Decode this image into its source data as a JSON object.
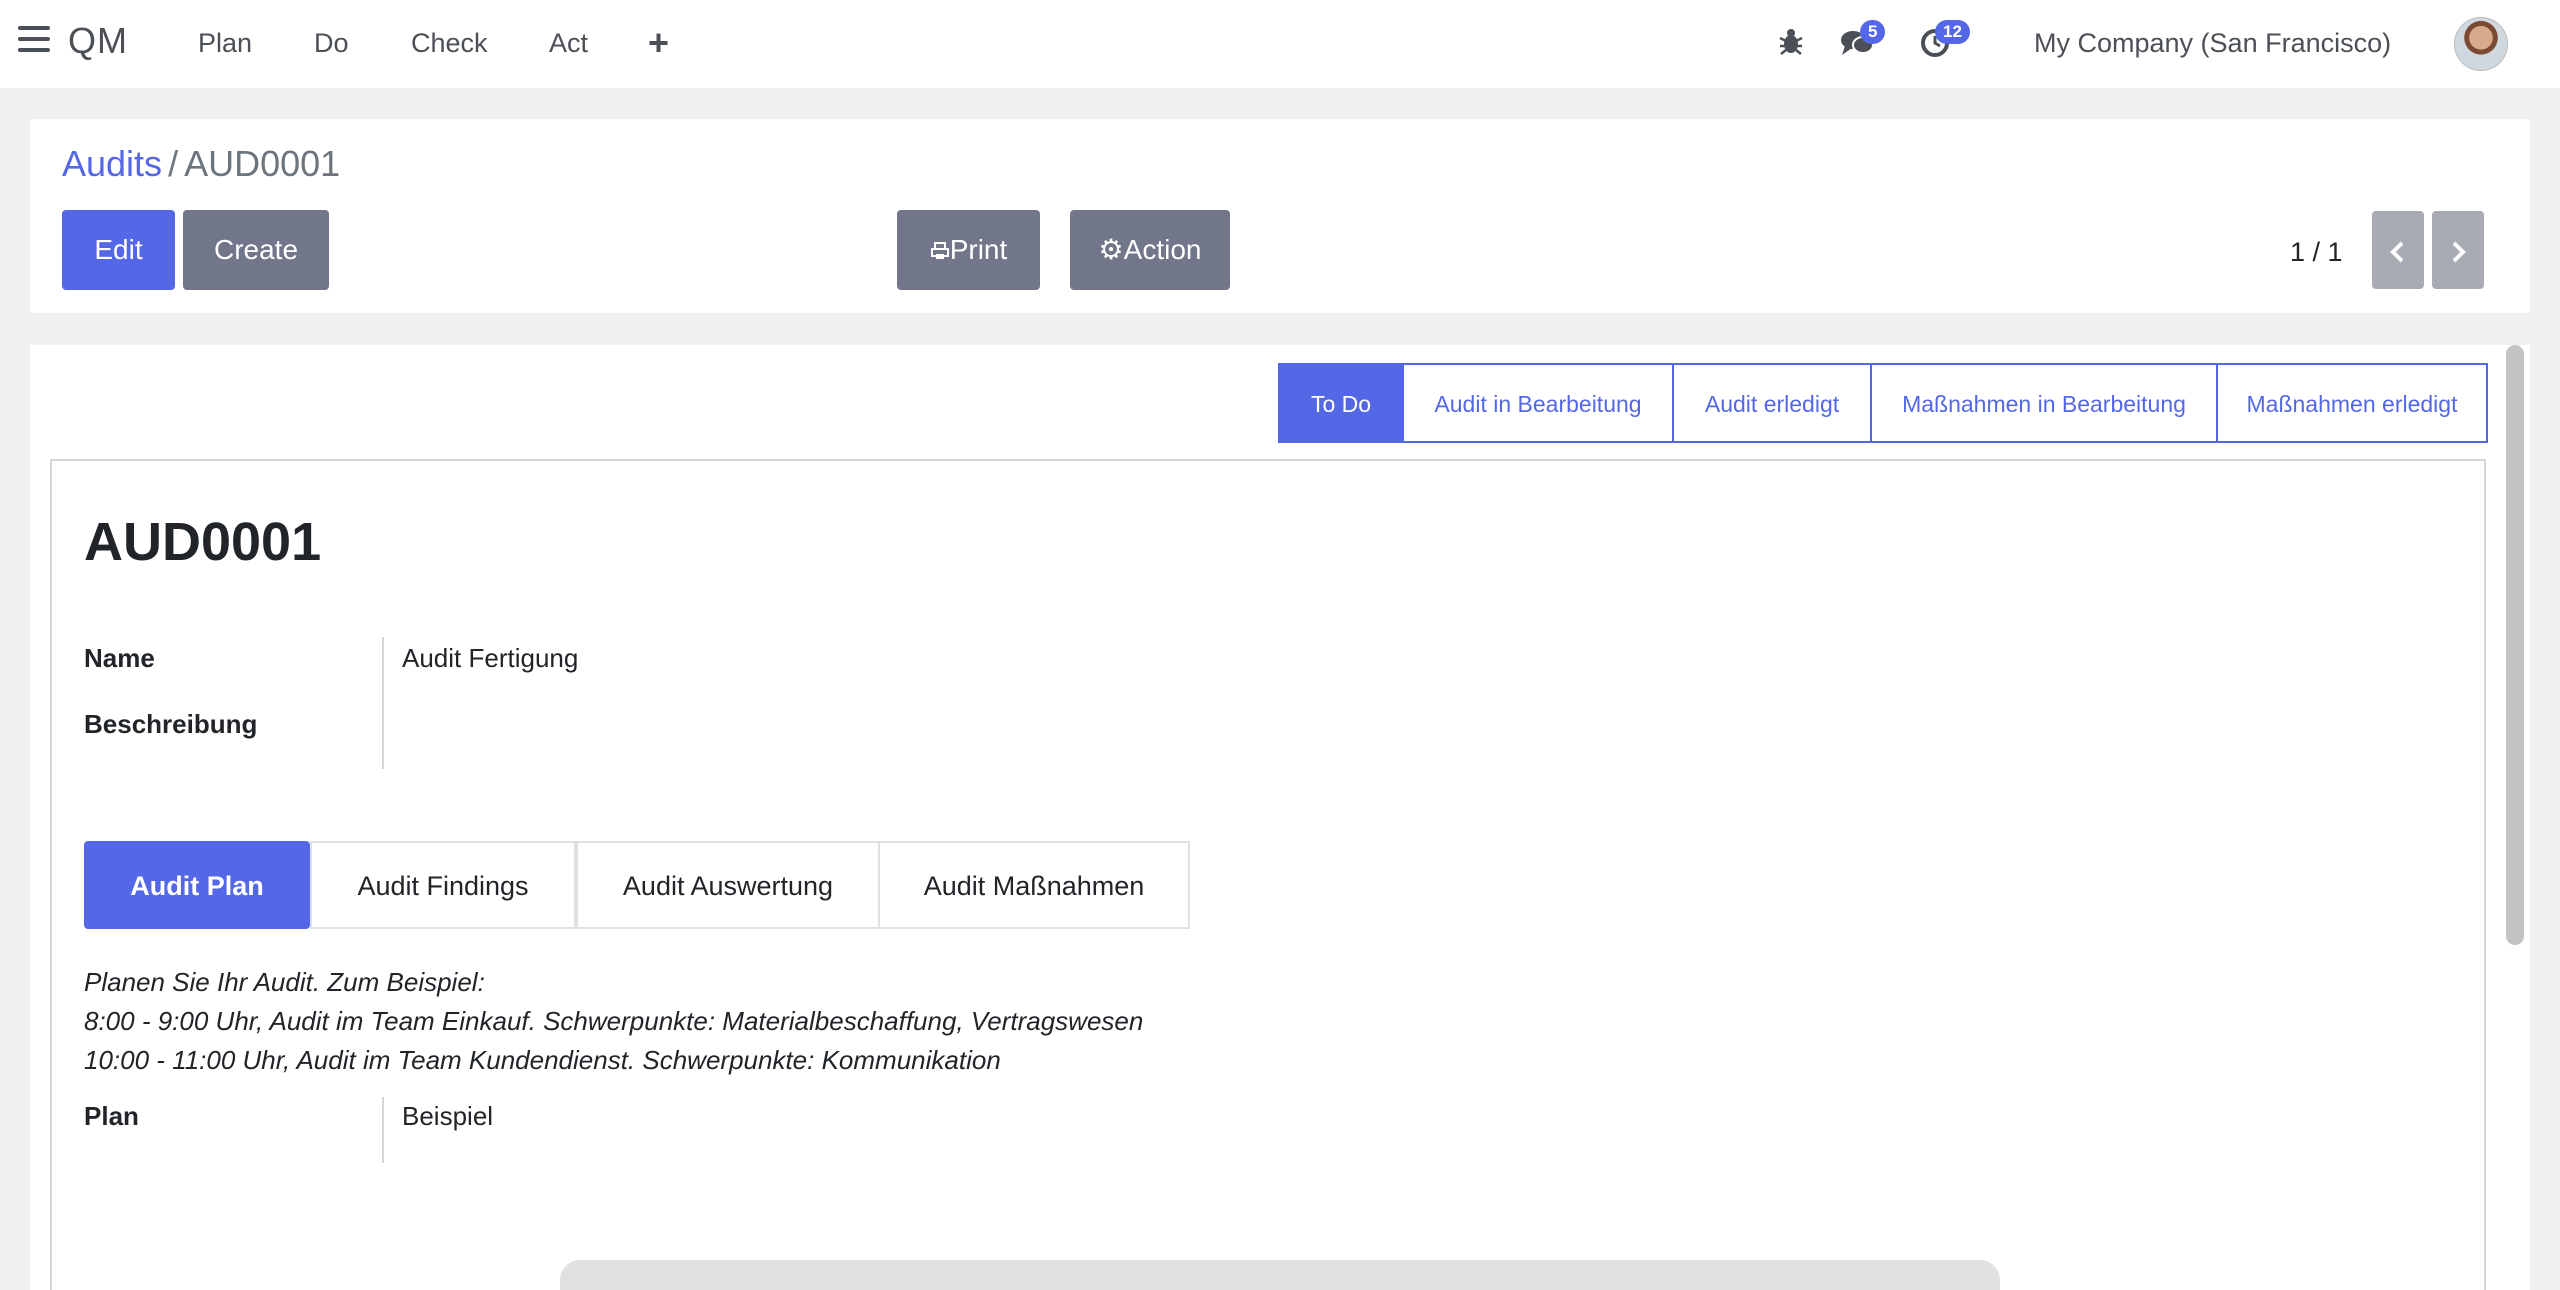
{
  "topbar": {
    "brand": "QM",
    "menu": [
      "Plan",
      "Do",
      "Check",
      "Act"
    ],
    "add_icon": "plus-icon",
    "messages_badge": "5",
    "activities_badge": "12",
    "company": "My Company (San Francisco)"
  },
  "control": {
    "breadcrumb_parent": "Audits",
    "breadcrumb_sep": "/",
    "breadcrumb_current": "AUD0001",
    "edit_label": "Edit",
    "create_label": "Create",
    "print_label": "Print",
    "action_label": "Action",
    "pager": "1 / 1"
  },
  "status": {
    "stages": [
      "To Do",
      "Audit in Bearbeitung",
      "Audit erledigt",
      "Maßnahmen in Bearbeitung",
      "Maßnahmen erledigt"
    ],
    "active_stage": "To Do"
  },
  "form": {
    "title": "AUD0001",
    "name_label": "Name",
    "name_value": "Audit Fertigung",
    "description_label": "Beschreibung",
    "tabs": [
      "Audit Plan",
      "Audit Findings",
      "Audit Auswertung",
      "Audit Maßnahmen"
    ],
    "active_tab": "Audit Plan",
    "help_lines": [
      "Planen Sie Ihr Audit. Zum Beispiel:",
      "8:00 - 9:00 Uhr, Audit im Team Einkauf. Schwerpunkte: Materialbeschaffung, Vertragswesen",
      "10:00 - 11:00 Uhr, Audit im Team Kundendienst. Schwerpunkte: Kommunikation"
    ],
    "plan_label": "Plan",
    "plan_value": "Beispiel"
  },
  "colors": {
    "primary": "#5468e7",
    "secondary": "#71768a",
    "background": "#f0f0f2"
  }
}
